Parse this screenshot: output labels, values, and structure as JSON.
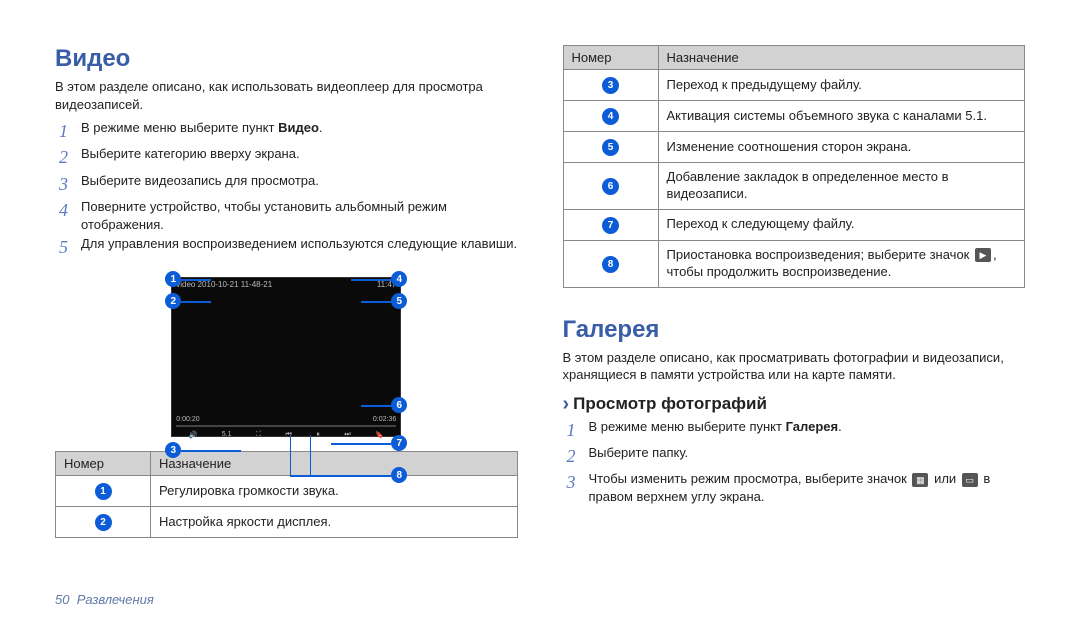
{
  "video": {
    "title": "Видео",
    "intro": "В этом разделе описано, как использовать видеоплеер для просмотра видеозаписей.",
    "steps": [
      "В режиме меню выберите пункт",
      "Выберите категорию вверху экрана.",
      "Выберите видеозапись для просмотра.",
      "Поверните устройство, чтобы установить альбомный режим отображения.",
      "Для управления воспроизведением используются следующие клавиши."
    ],
    "step1_bold": "Видео",
    "th_num": "Номер",
    "th_desc": "Назначение",
    "rows_left": [
      {
        "n": "1",
        "t": "Регулировка громкости звука."
      },
      {
        "n": "2",
        "t": "Настройка яркости дисплея."
      }
    ],
    "screen_top": "video 2010-10-21 11-48-21",
    "screen_time": "11:47",
    "screen_lt": "0:00:20",
    "screen_rt": "0:02:36"
  },
  "right_table": {
    "th_num": "Номер",
    "th_desc": "Назначение",
    "rows": [
      {
        "n": "3",
        "t": "Переход к предыдущему файлу."
      },
      {
        "n": "4",
        "t": "Активация системы объемного звука с каналами 5.1."
      },
      {
        "n": "5",
        "t": "Изменение соотношения сторон экрана."
      },
      {
        "n": "6",
        "t": "Добавление закладок в определенное место в видеозаписи."
      },
      {
        "n": "7",
        "t": "Переход к следующему файлу."
      }
    ],
    "row8_a": "Приостановка воспроизведения; выберите значок",
    "row8_b": ", чтобы продолжить воспроизведение."
  },
  "gallery": {
    "title": "Галерея",
    "intro": "В этом разделе описано, как просматривать фотографии и видеозаписи, хранящиеся в памяти устройства или на карте памяти.",
    "sub": "Просмотр фотографий",
    "step1_a": "В режиме меню выберите пункт",
    "step1_b": "Галерея",
    "step2": "Выберите папку.",
    "step3_a": "Чтобы изменить режим просмотра, выберите значок",
    "step3_mid": "или",
    "step3_b": "в правом верхнем углу экрана."
  },
  "footer": {
    "page": "50",
    "label": "Развлечения"
  }
}
